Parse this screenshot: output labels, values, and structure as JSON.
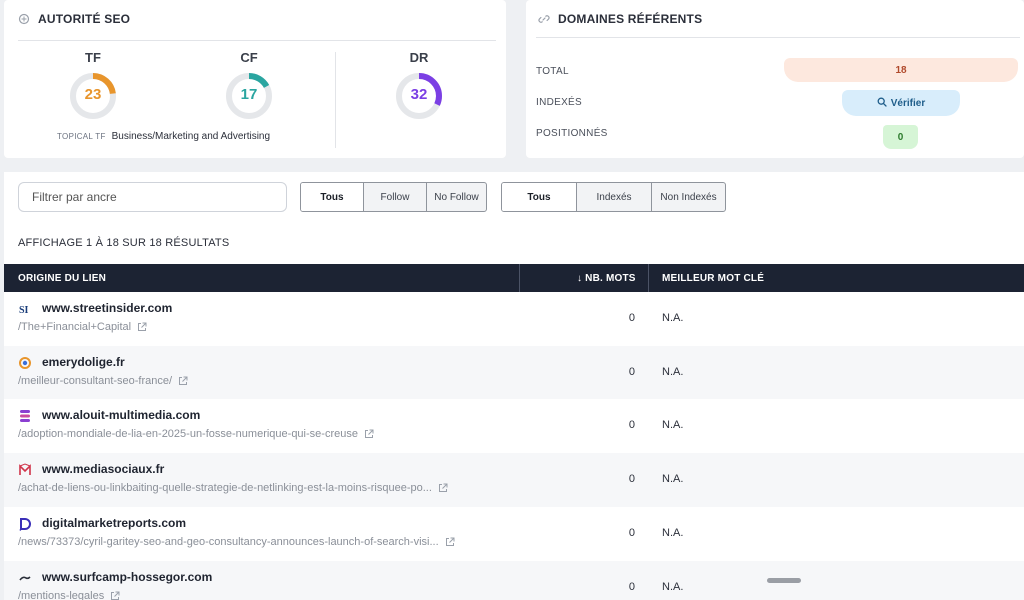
{
  "authority": {
    "title": "AUTORITÉ SEO",
    "metrics": [
      {
        "label": "TF",
        "value": "23",
        "fraction": 0.23,
        "color": "#e8952c"
      },
      {
        "label": "CF",
        "value": "17",
        "fraction": 0.17,
        "color": "#2aa5a0"
      },
      {
        "label": "DR",
        "value": "32",
        "fraction": 0.32,
        "color": "#7b3fe4"
      }
    ],
    "topical_key": "TOPICAL TF",
    "topical_value": "Business/Marketing and Advertising"
  },
  "domains": {
    "title": "DOMAINES RÉFÉRENTS",
    "total_label": "TOTAL",
    "total_value": "18",
    "indexed_label": "INDEXÉS",
    "verify_label": "Vérifier",
    "positioned_label": "POSITIONNÉS",
    "positioned_value": "0"
  },
  "filters": {
    "anchor_placeholder": "Filtrer par ancre",
    "follow_options": [
      "Tous",
      "Follow",
      "No Follow"
    ],
    "follow_selected": "Tous",
    "index_options": [
      "Tous",
      "Indexés",
      "Non Indexés"
    ],
    "index_selected": "Tous"
  },
  "results": {
    "summary": "AFFICHAGE 1 À 18 SUR 18 RÉSULTATS",
    "columns": {
      "origin": "ORIGINE DU LIEN",
      "words": "↓ NB. MOTS",
      "keyword": "MEILLEUR MOT CLÉ"
    },
    "rows": [
      {
        "domain": "www.streetinsider.com",
        "path": "/The+Financial+Capital",
        "words": "0",
        "keyword": "N.A.",
        "favicon": "si-favicon-icon"
      },
      {
        "domain": "emerydolige.fr",
        "path": "/meilleur-consultant-seo-france/",
        "words": "0",
        "keyword": "N.A.",
        "favicon": "ring-favicon-icon"
      },
      {
        "domain": "www.alouit-multimedia.com",
        "path": "/adoption-mondiale-de-lia-en-2025-un-fosse-numerique-qui-se-creuse",
        "words": "0",
        "keyword": "N.A.",
        "favicon": "stack-favicon-icon"
      },
      {
        "domain": "www.mediasociaux.fr",
        "path": "/achat-de-liens-ou-linkbaiting-quelle-strategie-de-netlinking-est-la-moins-risquee-po...",
        "words": "0",
        "keyword": "N.A.",
        "favicon": "m-favicon-icon"
      },
      {
        "domain": "digitalmarketreports.com",
        "path": "/news/73373/cyril-garitey-seo-and-geo-consultancy-announces-launch-of-search-visi...",
        "words": "0",
        "keyword": "N.A.",
        "favicon": "d-favicon-icon"
      },
      {
        "domain": "www.surfcamp-hossegor.com",
        "path": "/mentions-legales",
        "words": "0",
        "keyword": "N.A.",
        "favicon": "wave-favicon-icon"
      }
    ]
  }
}
